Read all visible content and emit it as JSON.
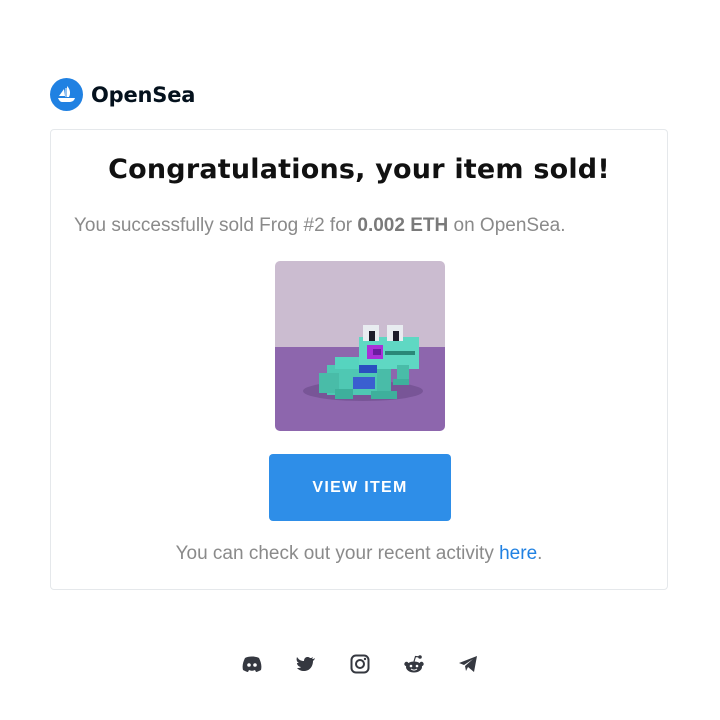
{
  "brand": {
    "name": "OpenSea",
    "accent_color": "#2081e2",
    "logo_icon": "opensea-ship-icon"
  },
  "card": {
    "title": "Congratulations, your item sold!",
    "message_prefix": "You successfully sold Frog #2 for ",
    "price": "0.002 ETH",
    "message_suffix": " on OpenSea.",
    "image_icon": "pixel-frog-nft",
    "button_label": "VIEW ITEM",
    "button_color": "#2e8ee8",
    "activity_prefix": "You can check out your recent activity ",
    "activity_link": "here",
    "activity_suffix": "."
  },
  "footer": {
    "social_icons": [
      "discord-icon",
      "twitter-icon",
      "instagram-icon",
      "reddit-icon",
      "telegram-icon"
    ]
  }
}
